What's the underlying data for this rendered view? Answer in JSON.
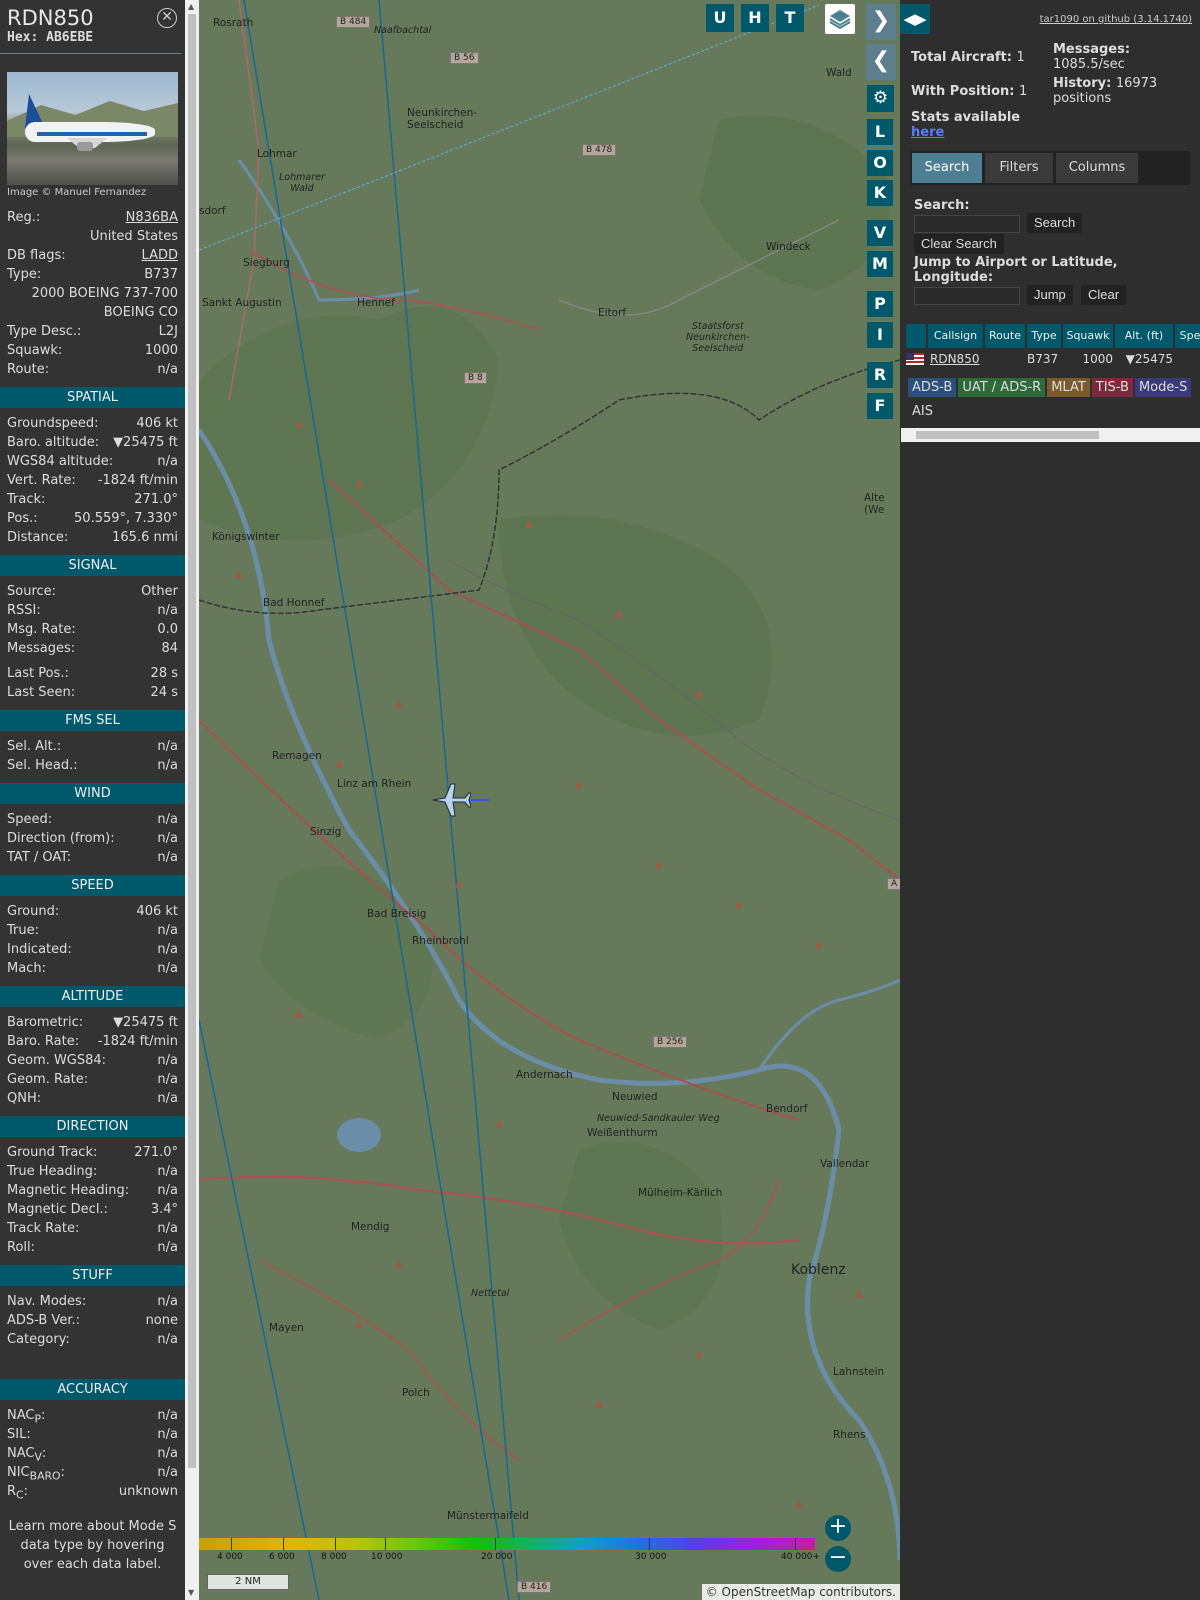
{
  "selected": {
    "callsign": "RDN850",
    "hex": "Hex: AB6EBE",
    "photo_credit": "Image © Manuel Fernandez",
    "basic": [
      {
        "label": "Reg.:",
        "value": "N836BA",
        "link": true
      },
      {
        "label": "",
        "value": "United States"
      },
      {
        "label": "DB flags:",
        "value": "LADD",
        "link": true
      },
      {
        "label": "Type:",
        "value": "B737"
      },
      {
        "label": "",
        "value": "2000 BOEING 737-700"
      },
      {
        "label": "",
        "value": "BOEING CO"
      },
      {
        "label": "Type Desc.:",
        "value": "L2J"
      },
      {
        "label": "Squawk:",
        "value": "1000"
      },
      {
        "label": "Route:",
        "value": "n/a"
      }
    ],
    "sections": [
      {
        "title": "SPATIAL",
        "rows": [
          {
            "label": "Groundspeed:",
            "value": "406 kt"
          },
          {
            "label": "Baro. altitude:",
            "value": "▼25475 ft"
          },
          {
            "label": "WGS84 altitude:",
            "value": "n/a"
          },
          {
            "label": "Vert. Rate:",
            "value": "-1824 ft/min"
          },
          {
            "label": "Track:",
            "value": "271.0°"
          },
          {
            "label": "Pos.:",
            "value": "50.559°, 7.330°"
          },
          {
            "label": "Distance:",
            "value": "165.6 nmi"
          }
        ]
      },
      {
        "title": "SIGNAL",
        "rows": [
          {
            "label": "Source:",
            "value": "Other"
          },
          {
            "label": "RSSI:",
            "value": "n/a"
          },
          {
            "label": "Msg. Rate:",
            "value": "0.0"
          },
          {
            "label": "Messages:",
            "value": "84"
          },
          {
            "gap": true
          },
          {
            "label": "Last Pos.:",
            "value": "28 s"
          },
          {
            "label": "Last Seen:",
            "value": "24 s"
          }
        ]
      },
      {
        "title": "FMS SEL",
        "rows": [
          {
            "label": "Sel. Alt.:",
            "value": "n/a"
          },
          {
            "label": "Sel. Head.:",
            "value": "n/a"
          }
        ]
      },
      {
        "title": "WIND",
        "rows": [
          {
            "label": "Speed:",
            "value": "n/a"
          },
          {
            "label": "Direction (from):",
            "value": "n/a"
          },
          {
            "label": "TAT / OAT:",
            "value": "n/a"
          }
        ]
      },
      {
        "title": "SPEED",
        "rows": [
          {
            "label": "Ground:",
            "value": "406 kt"
          },
          {
            "label": "True:",
            "value": "n/a"
          },
          {
            "label": "Indicated:",
            "value": "n/a"
          },
          {
            "label": "Mach:",
            "value": "n/a"
          }
        ]
      },
      {
        "title": "ALTITUDE",
        "rows": [
          {
            "label": "Barometric:",
            "value": "▼25475 ft"
          },
          {
            "label": "Baro. Rate:",
            "value": "-1824 ft/min"
          },
          {
            "label": "Geom. WGS84:",
            "value": "n/a"
          },
          {
            "label": "Geom. Rate:",
            "value": "n/a"
          },
          {
            "label": "QNH:",
            "value": "n/a"
          }
        ]
      },
      {
        "title": "DIRECTION",
        "rows": [
          {
            "label": "Ground Track:",
            "value": "271.0°"
          },
          {
            "label": "True Heading:",
            "value": "n/a"
          },
          {
            "label": "Magnetic Heading:",
            "value": "n/a"
          },
          {
            "label": "Magnetic Decl.:",
            "value": "3.4°"
          },
          {
            "label": "Track Rate:",
            "value": "n/a"
          },
          {
            "label": "Roll:",
            "value": "n/a"
          }
        ]
      },
      {
        "title": "STUFF",
        "rows": [
          {
            "label": "Nav. Modes:",
            "value": "n/a"
          },
          {
            "label": "ADS-B Ver.:",
            "value": "none"
          },
          {
            "label": "Category:",
            "value": "n/a"
          }
        ]
      },
      {
        "title": "ACCURACY",
        "gapBefore": true,
        "rows": [
          {
            "label": "NACP:",
            "value": "n/a",
            "html": "NAC<sub>P</sub>:"
          },
          {
            "label": "SIL:",
            "value": "n/a"
          },
          {
            "label": "NACV:",
            "value": "n/a",
            "html": "NAC<sub>V</sub>:"
          },
          {
            "label": "NICBARO:",
            "value": "n/a",
            "html": "NIC<sub>BARO</sub>:"
          },
          {
            "label": "RC:",
            "value": "unknown",
            "html": "R<sub>C</sub>:"
          }
        ]
      }
    ],
    "learn_more": "Learn more about Mode S data type by hovering over each data label."
  },
  "map": {
    "toolbar_top": [
      "U",
      "H",
      "T"
    ],
    "toolbar_side": [
      "L",
      "O",
      "K",
      "V",
      "M",
      "P",
      "I",
      "R",
      "F"
    ],
    "labels": [
      {
        "t": "Rosrath"
      },
      {
        "t": "Naafbachtal"
      },
      {
        "t": "Neunkirchen-\nSeelscheid"
      },
      {
        "t": "Lohmar"
      },
      {
        "t": "Lohmarer\nWald"
      },
      {
        "t": "sdorf"
      },
      {
        "t": "Siegburg"
      },
      {
        "t": "Sankt Augustin"
      },
      {
        "t": "Hennef"
      },
      {
        "t": "Eitorf"
      },
      {
        "t": "Windeck"
      },
      {
        "t": "Staatsforst\nNeunkirchen-\nSeelscheid"
      },
      {
        "t": "Königswinter"
      },
      {
        "t": "Bad Honnef"
      },
      {
        "t": "Remagen"
      },
      {
        "t": "Linz am Rhein"
      },
      {
        "t": "Sinzig"
      },
      {
        "t": "Bad Breisig"
      },
      {
        "t": "Rheinbrohl"
      },
      {
        "t": "Andernach"
      },
      {
        "t": "Neuwied"
      },
      {
        "t": "Neuwied-Sandkauler Weg"
      },
      {
        "t": "Weißenthurm"
      },
      {
        "t": "Bendorf"
      },
      {
        "t": "Vallendar"
      },
      {
        "t": "Mülheim-Kärlich"
      },
      {
        "t": "Koblenz"
      },
      {
        "t": "Mendig"
      },
      {
        "t": "Nettetal"
      },
      {
        "t": "Mayen"
      },
      {
        "t": "Polch"
      },
      {
        "t": "Lahnstein"
      },
      {
        "t": "Rhens"
      },
      {
        "t": "Münstermaifeld"
      },
      {
        "t": "Wald"
      },
      {
        "t": "Alte\n(We"
      }
    ],
    "road_badges": [
      "B 484",
      "B 56",
      "B 478",
      "B 8",
      "B 256",
      "B 416",
      "A"
    ],
    "colorbar_labels": [
      "4 000",
      "6 000",
      "8 000",
      "10 000",
      "20 000",
      "30 000",
      "40 000+"
    ],
    "scale": "2 NM",
    "attribution": "© OpenStreetMap contributors."
  },
  "right": {
    "github": "tar1090 on github (3.14.1740)",
    "total_aircraft_label": "Total Aircraft:",
    "total_aircraft": "1",
    "with_position_label": "With Position:",
    "with_position": "1",
    "messages_label": "Messages:",
    "messages": "1085.5/sec",
    "history_label": "History:",
    "history": "16973 positions",
    "stats_label": "Stats available",
    "stats_link": "here",
    "tabs": [
      "Search",
      "Filters",
      "Columns"
    ],
    "search_label": "Search:",
    "search_button": "Search",
    "clear_search_button": "Clear Search",
    "jump_label": "Jump to Airport or Latitude, Longitude:",
    "jump_button": "Jump",
    "clear_button": "Clear",
    "columns": [
      "",
      "Callsign",
      "Route",
      "Type",
      "Squawk",
      "Alt. (ft)",
      "Spe"
    ],
    "rows": [
      {
        "callsign": "RDN850",
        "route": "",
        "type": "B737",
        "squawk": "1000",
        "alt": "▼25475"
      }
    ],
    "sources": [
      {
        "label": "ADS-B",
        "bg": "#2c4e7a",
        "fg": "#ddd"
      },
      {
        "label": "UAT / ADS-R",
        "bg": "#2d6a3a",
        "fg": "#ddd"
      },
      {
        "label": "MLAT",
        "bg": "#7a5a2a",
        "fg": "#ddd"
      },
      {
        "label": "TIS-B",
        "bg": "#7a2a3a",
        "fg": "#ddd"
      },
      {
        "label": "Mode-S",
        "bg": "#3a3a7a",
        "fg": "#ddd"
      },
      {
        "label": "AIS",
        "bg": "transparent",
        "fg": "#ddd"
      }
    ]
  }
}
